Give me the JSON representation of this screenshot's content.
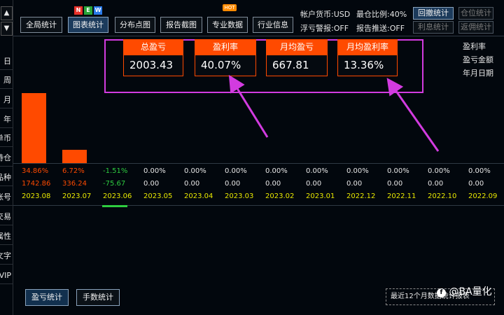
{
  "sidebar": {
    "up_arrow": "▲",
    "down_arrow": "▼",
    "items": [
      "日",
      "周",
      "月",
      "年",
      "单币",
      "持仓",
      "品种",
      "账号",
      "交易",
      "属性",
      "文字",
      "VIP"
    ]
  },
  "toolbar": {
    "buttons": [
      "全局统计",
      "图表统计",
      "分布点图",
      "报告截图",
      "专业数据",
      "行业信息"
    ],
    "new_badge": [
      "N",
      "E",
      "W"
    ],
    "hot_badge": "HOT",
    "account_currency": "帐户货币:USD",
    "max_position_ratio": "最仓比例:40%",
    "float_loss_alert": "浮亏警报:OFF",
    "report_push": "报告推送:OFF",
    "right_buttons": [
      "回撤统计",
      "仓位统计",
      "利息统计",
      "返佣统计"
    ]
  },
  "stats": [
    {
      "label": "总盈亏",
      "value": "2003.43"
    },
    {
      "label": "盈利率",
      "value": "40.07%"
    },
    {
      "label": "月均盈亏",
      "value": "667.81"
    },
    {
      "label": "月均盈利率",
      "value": "13.36%"
    }
  ],
  "legend": [
    "盈利率",
    "盈亏金额",
    "年月日期"
  ],
  "chart_data": {
    "type": "bar",
    "categories": [
      "2023.08",
      "2023.07",
      "2023.06",
      "2023.05",
      "2023.04",
      "2023.03",
      "2023.02",
      "2023.01",
      "2022.12",
      "2022.11",
      "2022.10",
      "2022.09"
    ],
    "profit_rate": [
      "34.86%",
      "6.72%",
      "-1.51%",
      "0.00%",
      "0.00%",
      "0.00%",
      "0.00%",
      "0.00%",
      "0.00%",
      "0.00%",
      "0.00%",
      "0.00%"
    ],
    "profit_amount": [
      "1742.86",
      "336.24",
      "-75.67",
      "0.00",
      "0.00",
      "0.00",
      "0.00",
      "0.00",
      "0.00",
      "0.00",
      "0.00",
      "0.00"
    ],
    "values": [
      1742.86,
      336.24,
      -75.67,
      0,
      0,
      0,
      0,
      0,
      0,
      0,
      0,
      0
    ],
    "colors": {
      "profit": "#ff4a00",
      "loss": "#2ecc40",
      "neutral": "#e6e6e6",
      "month": "#e8e800"
    }
  },
  "bottom": {
    "buttons": [
      "盈亏统计",
      "手数统计"
    ],
    "note": "最近12个月数据统计报表"
  },
  "watermark": {
    "icon": "f",
    "text": "@BA量化"
  },
  "colors": {
    "accent": "#ff4a00",
    "highlight": "#d23be0",
    "background": "#02070d"
  }
}
